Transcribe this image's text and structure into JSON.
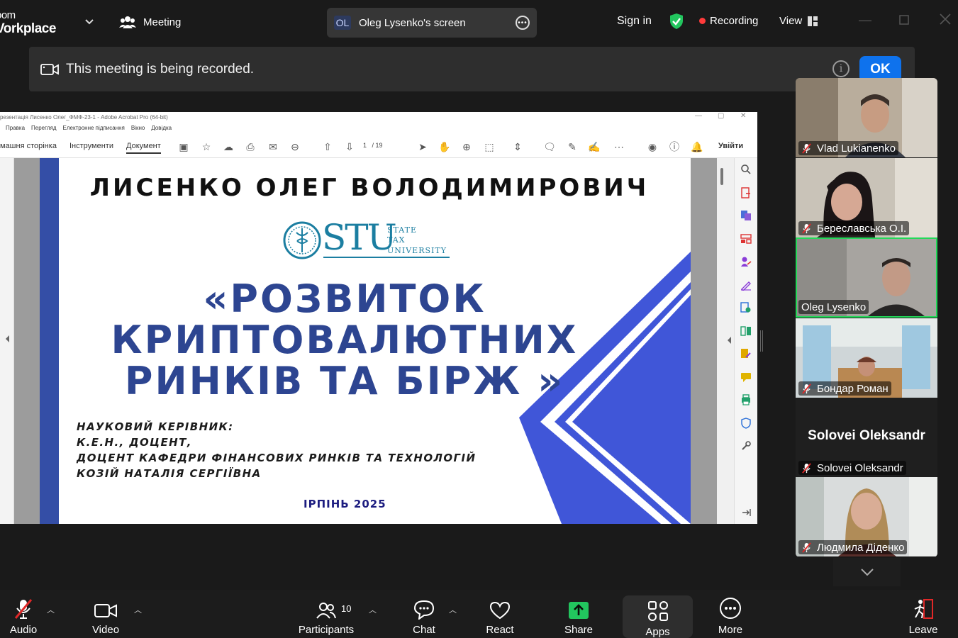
{
  "app": {
    "logo_line1": "oom",
    "logo_line2": "Vorkplace",
    "meeting_label": "Meeting",
    "screen_share_initials": "OL",
    "screen_share_label": "Oleg Lysenko's screen",
    "sign_in": "Sign in",
    "recording": "Recording",
    "view": "View"
  },
  "banner": {
    "message": "This meeting is being recorded.",
    "info_glyph": "i",
    "ok": "OK"
  },
  "acrobat": {
    "title": "резентація Лисенко Олег_ФМФ-23-1 - Adobe Acrobat Pro (64-bit)",
    "menu": [
      "Правка",
      "Перегляд",
      "Електронне підписання",
      "Вікно",
      "Довідка"
    ],
    "tabs": [
      "машня сторінка",
      "Інструменти",
      "Документ"
    ],
    "page_current": "1",
    "page_total": "/ 19",
    "sign_in": "Увійти"
  },
  "slide": {
    "author": "ЛИСЕНКО ОЛЕГ ВОЛОДИМИРОВИЧ",
    "logo_main": "STU",
    "logo_line1": "STATE",
    "logo_line2": "TAX",
    "logo_line3": "UNIVERSITY",
    "title_line1": "«РОЗВИТОК",
    "title_line2": "КРИПТОВАЛЮТНИХ",
    "title_line3": "РИНКІВ ТА БІРЖ »",
    "sup_line1": "НАУКОВИЙ КЕРІВНИК:",
    "sup_line2": "К.Е.Н., ДОЦЕНТ,",
    "sup_line3": "ДОЦЕНТ КАФЕДРИ ФІНАНСОВИХ РИНКІВ ТА ТЕХНОЛОГІЙ",
    "sup_line4": "КОЗІЙ НАТАЛІЯ СЕРГІЇВНА",
    "date_word": "ІРПІНЬ ",
    "date_year": "2025"
  },
  "participants": [
    {
      "name": "Vlad Lukianenko",
      "muted": true
    },
    {
      "name": "Береславська О.І.",
      "muted": true
    },
    {
      "name": "Oleg Lysenko",
      "muted": false,
      "active": true
    },
    {
      "name": "Бондар Роман",
      "muted": true
    },
    {
      "name": "Solovei Oleksandr",
      "muted": true,
      "video": false
    },
    {
      "name": "Людмила Діденко",
      "muted": true
    }
  ],
  "bottom_bar": {
    "audio": "Audio",
    "video": "Video",
    "participants": "Participants",
    "participants_count": "10",
    "chat": "Chat",
    "react": "React",
    "share": "Share",
    "apps": "Apps",
    "more": "More",
    "leave": "Leave"
  },
  "colors": {
    "accent_blue": "#0e72ed",
    "share_green": "#22c55e",
    "recording_red": "#ff3b3b",
    "active_speaker": "#23d959",
    "slide_blue": "#2d4591"
  }
}
